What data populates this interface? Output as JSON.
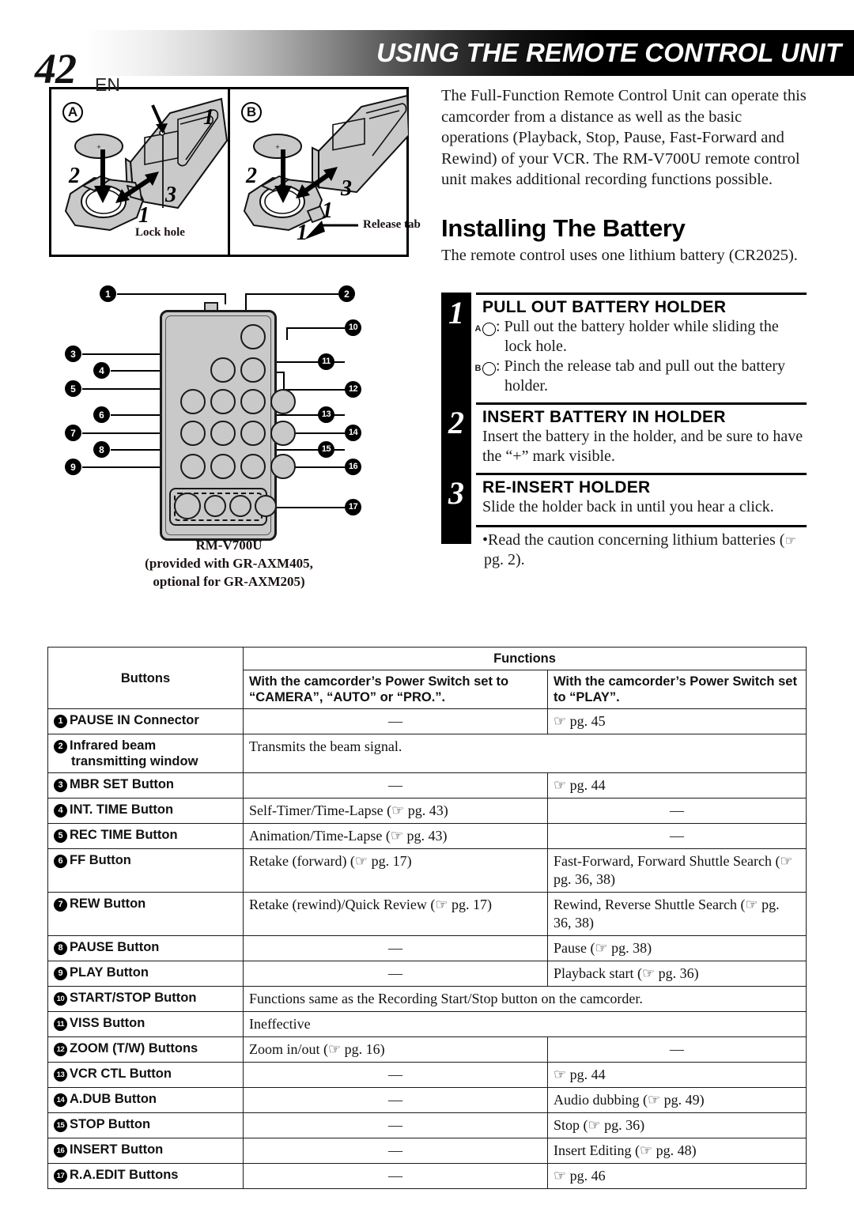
{
  "header": {
    "page_number": "42",
    "locale": "EN",
    "title": "USING THE REMOTE CONTROL UNIT"
  },
  "figures": {
    "panel_a": {
      "letter": "A",
      "numbers": [
        "1",
        "2",
        "3",
        "1"
      ],
      "label": "Lock hole"
    },
    "panel_b": {
      "letter": "B",
      "numbers": [
        "2",
        "3",
        "1",
        "1"
      ],
      "label": "Release tab"
    }
  },
  "remote_diagram": {
    "callouts": [
      "1",
      "2",
      "3",
      "4",
      "5",
      "6",
      "7",
      "8",
      "9",
      "10",
      "11",
      "12",
      "13",
      "14",
      "15",
      "16",
      "17"
    ],
    "caption_line1": "RM-V700U",
    "caption_line2": "(provided with GR-AXM405,",
    "caption_line3": "optional for GR-AXM205)"
  },
  "intro": {
    "paragraph": "The Full-Function Remote Control Unit can operate this camcorder from a distance as well as the basic operations (Playback, Stop, Pause, Fast-Forward and Rewind) of your VCR. The RM-V700U remote control unit makes additional recording functions possible."
  },
  "section": {
    "title": "Installing The Battery",
    "subtitle": "The remote control uses one lithium battery (CR2025)."
  },
  "steps": [
    {
      "number": "1",
      "heading": "PULL OUT BATTERY HOLDER",
      "bullets": [
        {
          "mark": "A",
          "text": ": Pull out the battery holder while sliding the lock hole."
        },
        {
          "mark": "B",
          "text": ": Pinch the release tab and pull out the battery holder."
        }
      ]
    },
    {
      "number": "2",
      "heading": "INSERT BATTERY IN HOLDER",
      "body": "Insert the battery in the holder, and be sure to have the “+” mark visible."
    },
    {
      "number": "3",
      "heading": "RE-INSERT HOLDER",
      "body": "Slide the holder back in until you hear a click."
    }
  ],
  "note": {
    "text": "•Read the caution concerning lithium batteries (",
    "page_ref": " pg. 2).",
    "hand_icon": "pointing-hand-icon"
  },
  "table": {
    "header": {
      "buttons": "Buttons",
      "functions": "Functions",
      "col_camera": "With the camcorder’s Power Switch set to “CAMERA”, “AUTO” or “PRO.”.",
      "col_play": "With the camcorder’s Power Switch set to “PLAY”."
    },
    "rows": [
      {
        "num": "1",
        "button": "PAUSE IN Connector",
        "button2": "",
        "camera": "—",
        "camera_center": true,
        "play": "☞ pg. 45",
        "span": false
      },
      {
        "num": "2",
        "button": "Infrared beam",
        "button2": "transmitting window",
        "camera": "Transmits the beam signal.",
        "camera_center": false,
        "play": "",
        "span": true
      },
      {
        "num": "3",
        "button": "MBR SET Button",
        "button2": "",
        "camera": "—",
        "camera_center": true,
        "play": "☞ pg. 44",
        "span": false
      },
      {
        "num": "4",
        "button": "INT. TIME Button",
        "button2": "",
        "camera": "Self-Timer/Time-Lapse (☞ pg. 43)",
        "camera_center": false,
        "play": "—",
        "play_center": true,
        "span": false
      },
      {
        "num": "5",
        "button": "REC TIME Button",
        "button2": "",
        "camera": "Animation/Time-Lapse (☞ pg. 43)",
        "camera_center": false,
        "play": "—",
        "play_center": true,
        "span": false
      },
      {
        "num": "6",
        "button": "FF Button",
        "button2": "",
        "camera": "Retake (forward) (☞ pg. 17)",
        "camera_center": false,
        "play": "Fast-Forward, Forward Shuttle Search (☞ pg. 36, 38)",
        "span": false
      },
      {
        "num": "7",
        "button": "REW Button",
        "button2": "",
        "camera": "Retake (rewind)/Quick Review (☞ pg. 17)",
        "camera_center": false,
        "play": "Rewind, Reverse Shuttle Search (☞ pg. 36, 38)",
        "span": false
      },
      {
        "num": "8",
        "button": "PAUSE Button",
        "button2": "",
        "camera": "—",
        "camera_center": true,
        "play": "Pause (☞ pg. 38)",
        "span": false
      },
      {
        "num": "9",
        "button": "PLAY Button",
        "button2": "",
        "camera": "—",
        "camera_center": true,
        "play": "Playback start (☞ pg. 36)",
        "span": false
      },
      {
        "num": "10",
        "button": "START/STOP Button",
        "button2": "",
        "camera": "Functions same as the Recording Start/Stop button on the camcorder.",
        "camera_center": false,
        "play": "",
        "span": true
      },
      {
        "num": "11",
        "button": "VISS Button",
        "button2": "",
        "camera": "Ineffective",
        "camera_center": false,
        "play": "",
        "span": true
      },
      {
        "num": "12",
        "button": "ZOOM (T/W) Buttons",
        "button2": "",
        "camera": "Zoom in/out (☞ pg. 16)",
        "camera_center": false,
        "play": "—",
        "play_center": true,
        "span": false
      },
      {
        "num": "13",
        "button": "VCR CTL Button",
        "button2": "",
        "camera": "—",
        "camera_center": true,
        "play": "☞ pg. 44",
        "span": false
      },
      {
        "num": "14",
        "button": "A.DUB Button",
        "button2": "",
        "camera": "—",
        "camera_center": true,
        "play": "Audio dubbing (☞ pg. 49)",
        "span": false
      },
      {
        "num": "15",
        "button": "STOP Button",
        "button2": "",
        "camera": "—",
        "camera_center": true,
        "play": "Stop (☞ pg. 36)",
        "span": false
      },
      {
        "num": "16",
        "button": "INSERT Button",
        "button2": "",
        "camera": "—",
        "camera_center": true,
        "play": "Insert Editing (☞ pg. 48)",
        "span": false
      },
      {
        "num": "17",
        "button": "R.A.EDIT Buttons",
        "button2": "",
        "camera": "—",
        "camera_center": true,
        "play": "☞ pg. 46",
        "span": false
      }
    ]
  }
}
